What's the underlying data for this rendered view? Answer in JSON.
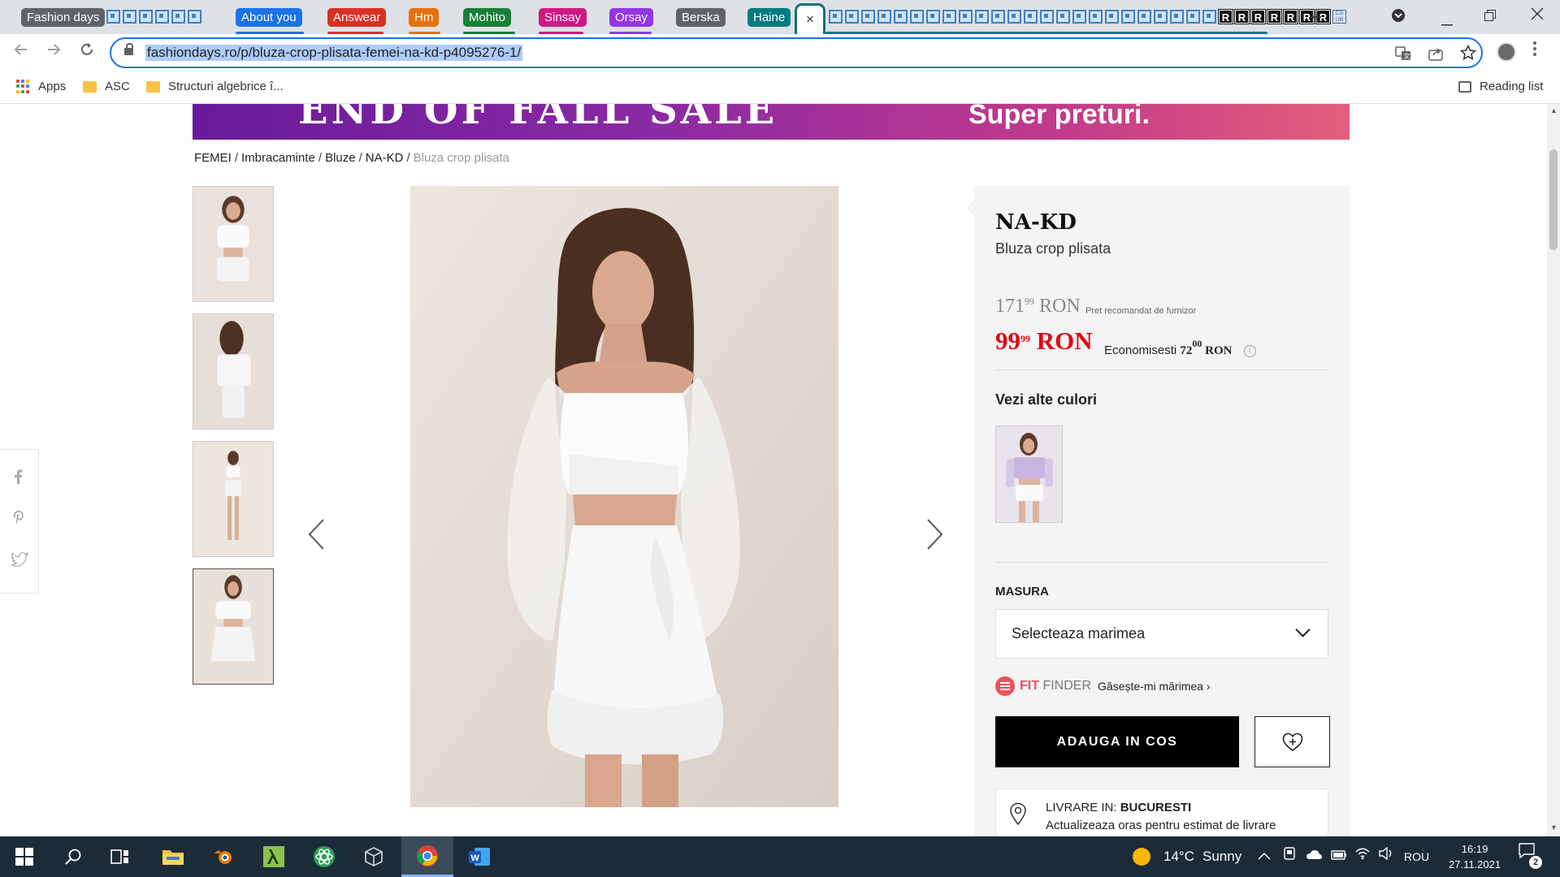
{
  "tabs": {
    "groups": [
      {
        "label": "Fashion days",
        "color": "#5f6368"
      },
      {
        "label": "About you",
        "color": "#1a73e8"
      },
      {
        "label": "Answear",
        "color": "#d93025"
      },
      {
        "label": "Hm",
        "color": "#e8710a"
      },
      {
        "label": "Mohito",
        "color": "#188038"
      },
      {
        "label": "Sinsay",
        "color": "#d01884"
      },
      {
        "label": "Orsay",
        "color": "#9334e6"
      },
      {
        "label": "Berska",
        "color": "#5f6368"
      },
      {
        "label": "Haine",
        "color": "#007b83"
      }
    ],
    "close_icon": "×",
    "new_tab_icon": "+",
    "cs_favicon": "CS UB",
    "r_favicon": "R"
  },
  "toolbar": {
    "url": "fashiondays.ro/p/bluza-crop-plisata-femei-na-kd-p4095276-1/"
  },
  "bookmarks": {
    "apps": "Apps",
    "items": [
      "ASC",
      "Structuri algebrice î..."
    ],
    "reading_list": "Reading list"
  },
  "banner": {
    "left_text": "END OF FALL SALE",
    "right_text": "Super preturi."
  },
  "breadcrumb": {
    "items": [
      "FEMEI",
      "Imbracaminte",
      "Bluze",
      "NA-KD"
    ],
    "current": "Bluza crop plisata",
    "separator": "/"
  },
  "product": {
    "brand": "NA-KD",
    "name": "Bluza crop plisata",
    "old_price_int": "171",
    "old_price_dec": "99",
    "currency": "RON",
    "recommended_label": "Pret recomandat de furnizor",
    "new_price_int": "99",
    "new_price_dec": "99",
    "savings_label": "Economisesti",
    "savings_int": "72",
    "savings_dec": "00",
    "info_icon": "i",
    "colors_title": "Vezi alte culori",
    "size_label": "MASURA",
    "size_placeholder": "Selecteaza marimea",
    "fit_brand": "FIT",
    "fit_brand2": "FINDER",
    "fit_link": "Găsește-mi mărimea ›",
    "add_to_cart": "ADAUGA IN COS",
    "delivery_label": "LIVRARE IN:",
    "delivery_city": "BUCURESTI",
    "delivery_sub": "Actualizeaza oras pentru estimat de livrare"
  },
  "share": {
    "facebook": "f",
    "pinterest": "p",
    "twitter": "🐦"
  },
  "taskbar": {
    "weather_temp": "14°C",
    "weather_desc": "Sunny",
    "language": "ROU",
    "time": "16:19",
    "date": "27.11.2021",
    "notifications": "2"
  }
}
